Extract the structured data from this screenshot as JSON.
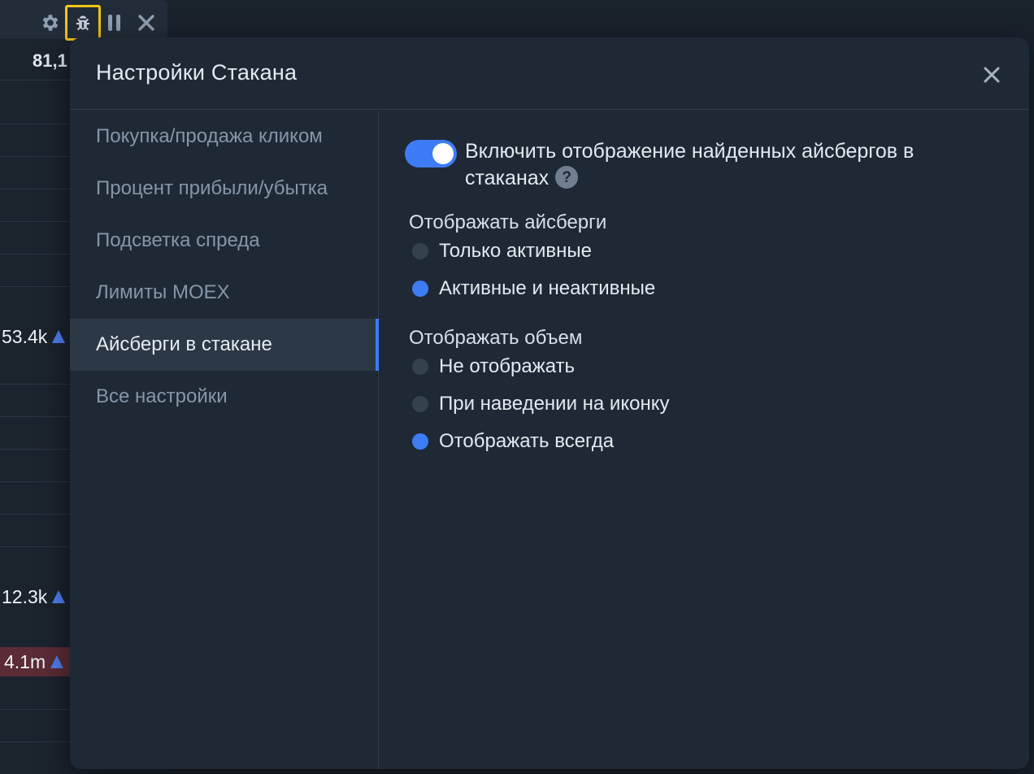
{
  "toolbar": {
    "icons": [
      "gear-icon",
      "bug-icon",
      "pause-icon",
      "close-icon"
    ]
  },
  "order_book": {
    "price": "81,1",
    "volumes": [
      "53.4k",
      "12.3k",
      "4.1m"
    ]
  },
  "modal": {
    "title": "Настройки Стакана",
    "nav": [
      {
        "label": "Покупка/продажа кликом"
      },
      {
        "label": "Процент прибыли/убытка"
      },
      {
        "label": "Подсветка спреда"
      },
      {
        "label": "Лимиты MOEX"
      },
      {
        "label": "Айсберги в стакане",
        "active": true
      },
      {
        "label": "Все настройки"
      }
    ],
    "toggle": {
      "label": "Включить отображение найденных айсбергов в стаканах",
      "on": true,
      "help": "?"
    },
    "show_icebergs": {
      "title": "Отображать айсберги",
      "options": [
        {
          "label": "Только активные",
          "selected": false
        },
        {
          "label": "Активные и неактивные",
          "selected": true
        }
      ]
    },
    "show_volume": {
      "title": "Отображать объем",
      "options": [
        {
          "label": "Не отображать",
          "selected": false
        },
        {
          "label": "При наведении на иконку",
          "selected": false
        },
        {
          "label": "Отображать всегда",
          "selected": true
        }
      ]
    }
  },
  "colors": {
    "accent": "#3d7cf5",
    "highlight_border": "#f5c518",
    "modal_bg": "#1f2935",
    "sell_row": "#5b2c36"
  }
}
